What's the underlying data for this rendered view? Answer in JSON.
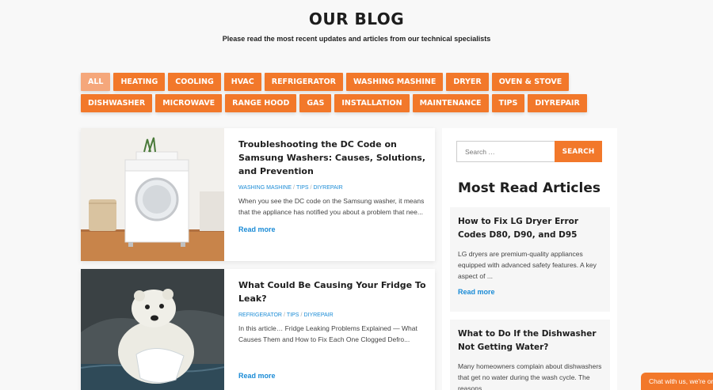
{
  "header": {
    "title": "OUR BLOG",
    "subtitle": "Please read the most recent updates and articles from our technical specialists"
  },
  "filters": {
    "row1": [
      "ALL",
      "HEATING",
      "COOLING",
      "HVAC",
      "REFRIGERATOR",
      "WASHING MASHINE",
      "DRYER",
      "OVEN & STOVE"
    ],
    "row2": [
      "DISHWASHER",
      "MICROWAVE",
      "RANGE HOOD",
      "GAS",
      "INSTALLATION",
      "MAINTENANCE",
      "TIPS",
      "DIYREPAIR"
    ],
    "active": "ALL"
  },
  "posts": [
    {
      "title": "Troubleshooting the DC Code on Samsung Washers: Causes, Solutions, and Prevention",
      "tags": [
        "WASHING MASHINE",
        "TIPS",
        "DIYREPAIR"
      ],
      "excerpt": "When you see the DC code on the Samsung washer, it means that the appliance has notified you about a problem that nee...",
      "read_more": "Read more"
    },
    {
      "title": "What Could Be Causing Your Fridge To Leak?",
      "tags": [
        "REFRIGERATOR",
        "TIPS",
        "DIYREPAIR"
      ],
      "excerpt": "In this article… Fridge Leaking Problems Explained — What Causes Them and How to Fix Each One Clogged Defro...",
      "read_more": "Read more"
    }
  ],
  "sidebar": {
    "search_placeholder": "Search …",
    "search_button": "SEARCH",
    "title": "Most Read Articles",
    "articles": [
      {
        "title": "How to Fix LG Dryer Error Codes D80, D90, and D95",
        "excerpt": "LG dryers are premium-quality appliances equipped with advanced safety features. A key aspect of ...",
        "read_more": "Read more"
      },
      {
        "title": "What to Do If the Dishwasher Not Getting Water?",
        "excerpt": "Many homeowners complain about dishwashers that get no water during the wash cycle. The reasons..."
      }
    ]
  },
  "chat": {
    "label": "Chat with us, we're online"
  },
  "colors": {
    "accent": "#f2782a",
    "active_chip": "#f5a77b",
    "link": "#1a8bd6"
  }
}
